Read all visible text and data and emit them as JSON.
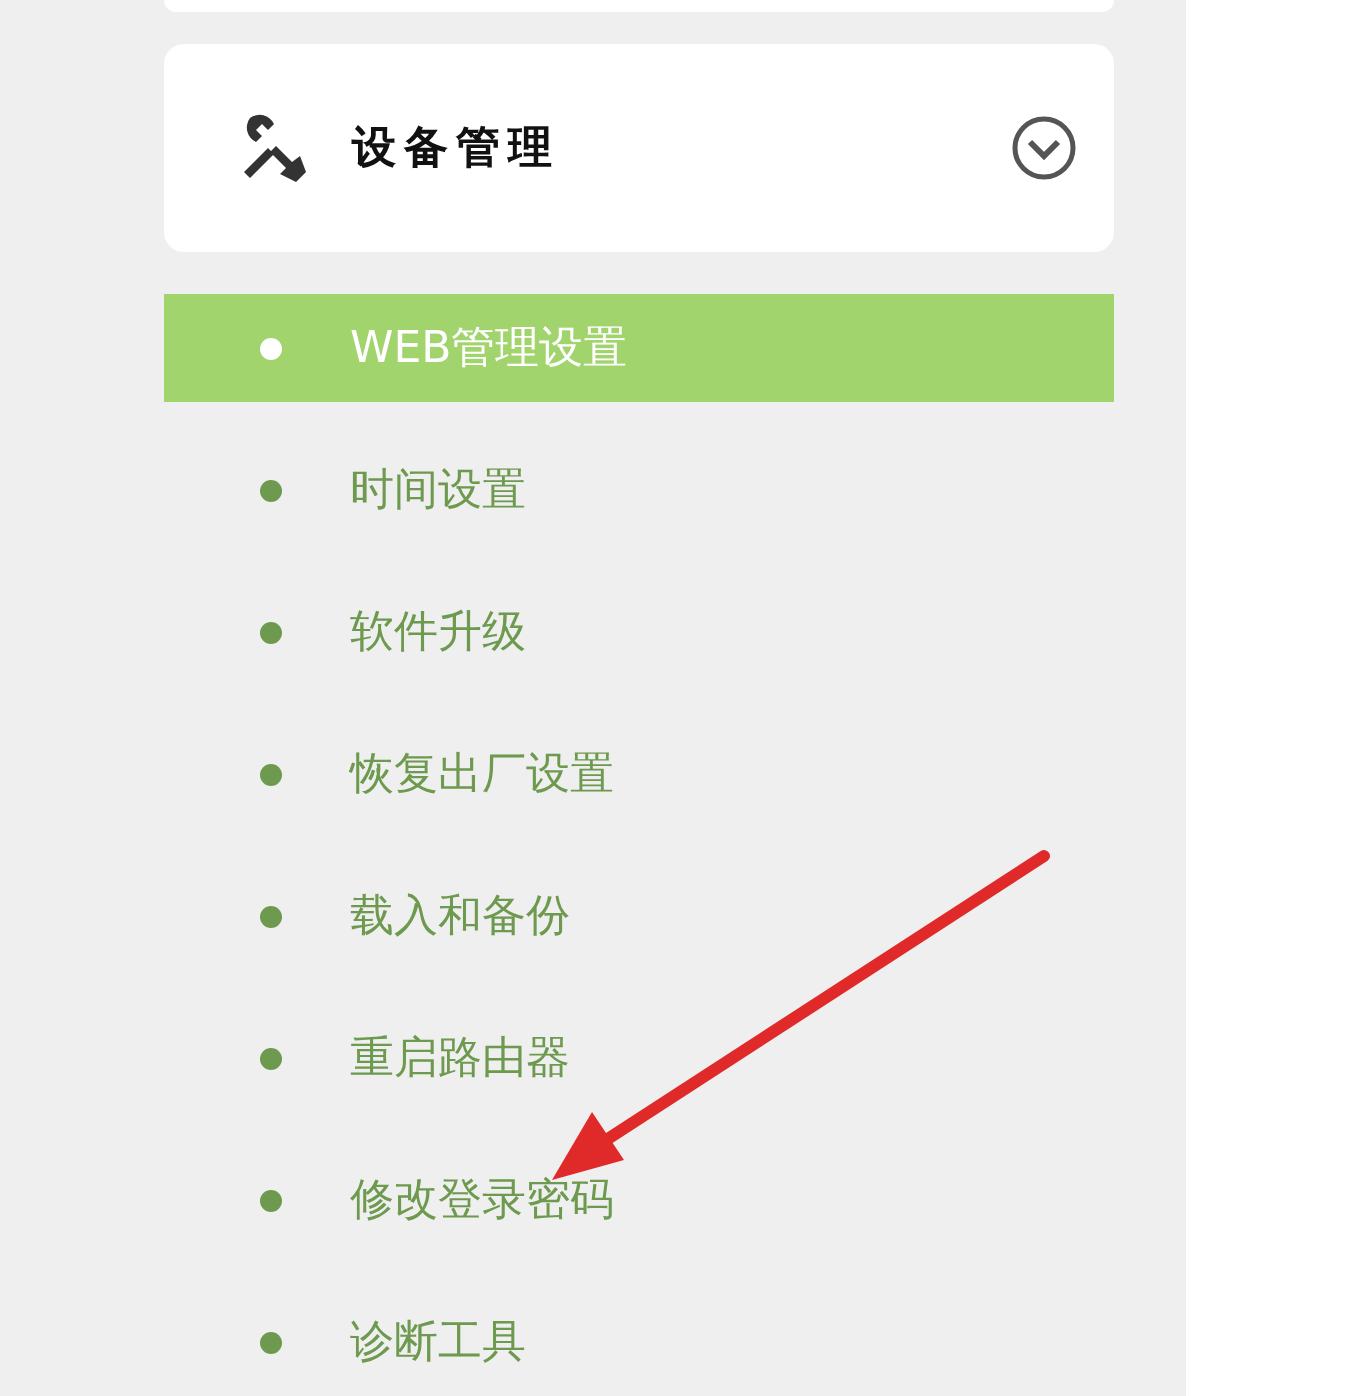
{
  "section": {
    "title": "设备管理"
  },
  "menu_items": [
    {
      "label": "WEB管理设置",
      "selected": true
    },
    {
      "label": "时间设置",
      "selected": false
    },
    {
      "label": "软件升级",
      "selected": false
    },
    {
      "label": "恢复出厂设置",
      "selected": false
    },
    {
      "label": "载入和备份",
      "selected": false
    },
    {
      "label": "重启路由器",
      "selected": false
    },
    {
      "label": "修改登录密码",
      "selected": false
    },
    {
      "label": "诊断工具",
      "selected": false
    }
  ]
}
